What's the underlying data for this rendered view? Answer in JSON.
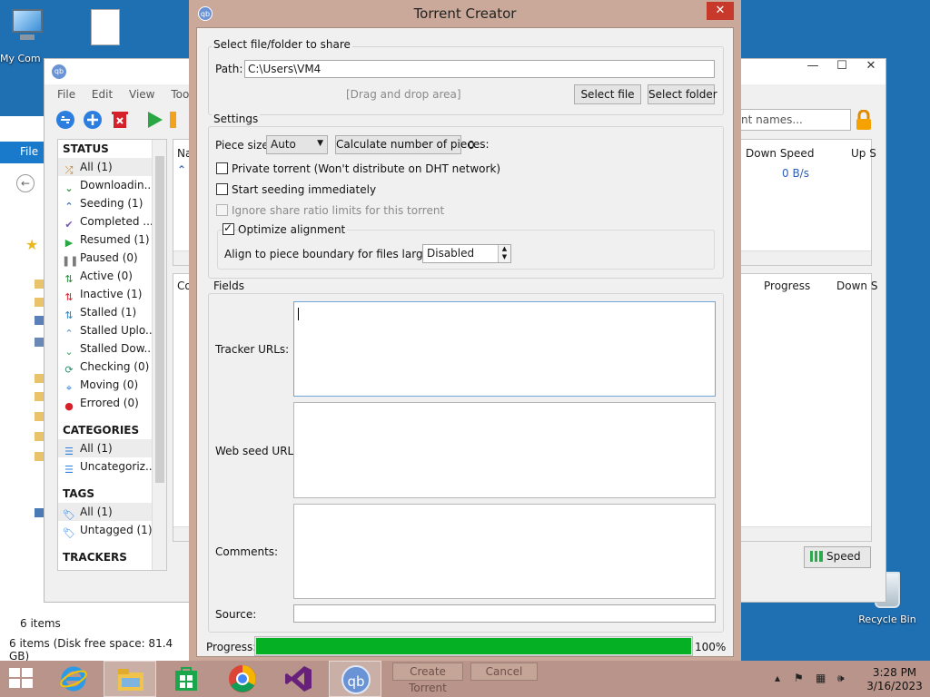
{
  "desktop": {
    "my_computer_label": "My Com",
    "recycle_bin_label": "Recycle Bin"
  },
  "explorer": {
    "file_tab": "File",
    "items_count": "6 items",
    "status_bar": "6 items (Disk free space: 81.4 GB)"
  },
  "qbittorrent": {
    "menu": [
      "File",
      "Edit",
      "View",
      "Tools"
    ],
    "filter_placeholder": "nt names...",
    "sidebar": {
      "status_header": "STATUS",
      "status_items": [
        "All (1)",
        "Downloadin...",
        "Seeding (1)",
        "Completed ...",
        "Resumed (1)",
        "Paused (0)",
        "Active (0)",
        "Inactive (1)",
        "Stalled (1)",
        "Stalled Uplo...",
        "Stalled Dow...",
        "Checking (0)",
        "Moving (0)",
        "Errored (0)"
      ],
      "categories_header": "CATEGORIES",
      "category_items": [
        "All (1)",
        "Uncategoriz..."
      ],
      "tags_header": "TAGS",
      "tag_items": [
        "All (1)",
        "Untagged (1)"
      ],
      "trackers_header": "TRACKERS"
    },
    "torrent_list": {
      "col_name": "Na",
      "col_down_speed": "Down Speed",
      "col_up_speed": "Up S",
      "row_down_speed": "0 B/s"
    },
    "properties": {
      "col_first": "Co",
      "col_progress": "Progress",
      "col_down": "Down S"
    },
    "speed_button": "Speed"
  },
  "torrent_creator": {
    "title": "Torrent Creator",
    "select_group_title": "Select file/folder to share",
    "path_label": "Path:",
    "path_value": "C:\\Users\\VM4",
    "drag_drop_hint": "[Drag and drop area]",
    "select_file_button": "Select file",
    "select_folder_button": "Select folder",
    "settings_group_title": "Settings",
    "piece_size_label": "Piece size:",
    "piece_size_value": "Auto",
    "calc_pieces_button": "Calculate number of pieces:",
    "pieces_count": "0",
    "private_torrent_label": "Private torrent (Won't distribute on DHT network)",
    "start_seeding_label": "Start seeding immediately",
    "ignore_ratio_label": "Ignore share ratio limits for this torrent",
    "optimize_alignment_label": "Optimize alignment",
    "align_label": "Align to piece boundary for files larger than:",
    "align_value": "Disabled",
    "fields_group_title": "Fields",
    "tracker_urls_label": "Tracker URLs:",
    "web_seed_urls_label": "Web seed URLs:",
    "comments_label": "Comments:",
    "source_label": "Source:",
    "progress_label": "Progress:",
    "progress_value": 1.0,
    "progress_text": "100%",
    "create_button": "Create Torrent",
    "cancel_button": "Cancel",
    "checkboxes": {
      "private_torrent": false,
      "start_seeding": false,
      "ignore_ratio": false,
      "optimize_alignment": true
    }
  },
  "taskbar": {
    "time": "3:28 PM",
    "date": "3/16/2023",
    "pinned": [
      "start-icon",
      "internet-explorer-icon",
      "file-explorer-icon",
      "store-icon",
      "chrome-icon",
      "visual-studio-icon",
      "qbittorrent-icon"
    ],
    "tray_icons": [
      "chevron-up-icon",
      "flag-icon",
      "network-icon",
      "volume-icon"
    ]
  },
  "colors": {
    "progress_green": "#06b025",
    "close_red": "#c7392b",
    "window_frame": "#caa99a",
    "taskbar": "#b8948a",
    "desktop_blue": "#1f6fb3"
  }
}
